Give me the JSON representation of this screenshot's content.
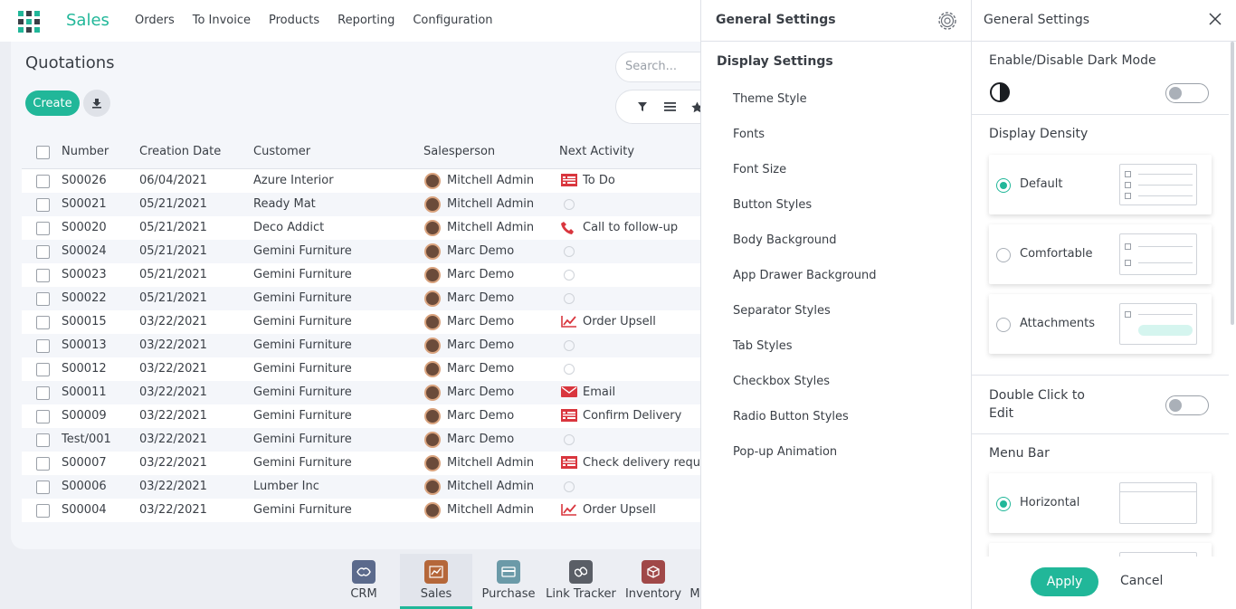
{
  "navbar": {
    "brand": "Sales",
    "menu": [
      "Orders",
      "To Invoice",
      "Products",
      "Reporting",
      "Configuration"
    ]
  },
  "page": {
    "title": "Quotations",
    "create_label": "Create",
    "search_placeholder": "Search..."
  },
  "table": {
    "headers": [
      "Number",
      "Creation Date",
      "Customer",
      "Salesperson",
      "Next Activity"
    ],
    "rows": [
      {
        "number": "S00026",
        "date": "06/04/2021",
        "customer": "Azure Interior",
        "salesperson": "Mitchell Admin",
        "activity": "To Do",
        "activity_icon": "todo-icon"
      },
      {
        "number": "S00021",
        "date": "05/21/2021",
        "customer": "Ready Mat",
        "salesperson": "Mitchell Admin",
        "activity": "",
        "activity_icon": "clock-icon"
      },
      {
        "number": "S00020",
        "date": "05/21/2021",
        "customer": "Deco Addict",
        "salesperson": "Mitchell Admin",
        "activity": "Call to follow-up",
        "activity_icon": "phone-icon"
      },
      {
        "number": "S00024",
        "date": "05/21/2021",
        "customer": "Gemini Furniture",
        "salesperson": "Marc Demo",
        "activity": "",
        "activity_icon": "clock-icon"
      },
      {
        "number": "S00023",
        "date": "05/21/2021",
        "customer": "Gemini Furniture",
        "salesperson": "Marc Demo",
        "activity": "",
        "activity_icon": "clock-icon"
      },
      {
        "number": "S00022",
        "date": "05/21/2021",
        "customer": "Gemini Furniture",
        "salesperson": "Marc Demo",
        "activity": "",
        "activity_icon": "clock-icon"
      },
      {
        "number": "S00015",
        "date": "03/22/2021",
        "customer": "Gemini Furniture",
        "salesperson": "Marc Demo",
        "activity": "Order Upsell",
        "activity_icon": "upsell-icon"
      },
      {
        "number": "S00013",
        "date": "03/22/2021",
        "customer": "Gemini Furniture",
        "salesperson": "Marc Demo",
        "activity": "",
        "activity_icon": "clock-icon"
      },
      {
        "number": "S00012",
        "date": "03/22/2021",
        "customer": "Gemini Furniture",
        "salesperson": "Marc Demo",
        "activity": "",
        "activity_icon": "clock-icon"
      },
      {
        "number": "S00011",
        "date": "03/22/2021",
        "customer": "Gemini Furniture",
        "salesperson": "Marc Demo",
        "activity": "Email",
        "activity_icon": "email-icon"
      },
      {
        "number": "S00009",
        "date": "03/22/2021",
        "customer": "Gemini Furniture",
        "salesperson": "Marc Demo",
        "activity": "Confirm Delivery",
        "activity_icon": "todo-icon"
      },
      {
        "number": "Test/001",
        "date": "03/22/2021",
        "customer": "Gemini Furniture",
        "salesperson": "Marc Demo",
        "activity": "",
        "activity_icon": "clock-icon"
      },
      {
        "number": "S00007",
        "date": "03/22/2021",
        "customer": "Gemini Furniture",
        "salesperson": "Mitchell Admin",
        "activity": "Check delivery require",
        "activity_icon": "todo-icon"
      },
      {
        "number": "S00006",
        "date": "03/22/2021",
        "customer": "Lumber Inc",
        "salesperson": "Mitchell Admin",
        "activity": "",
        "activity_icon": "clock-icon"
      },
      {
        "number": "S00004",
        "date": "03/22/2021",
        "customer": "Gemini Furniture",
        "salesperson": "Mitchell Admin",
        "activity": "Order Upsell",
        "activity_icon": "upsell-icon"
      }
    ]
  },
  "appbar": {
    "apps": [
      {
        "label": "CRM",
        "icon": "crm-icon",
        "color": "#5b6a8c"
      },
      {
        "label": "Sales",
        "icon": "sales-icon",
        "color": "#b5673a",
        "active": true
      },
      {
        "label": "Purchase",
        "icon": "purchase-icon",
        "color": "#6b9aa8"
      },
      {
        "label": "Link Tracker",
        "icon": "link-icon",
        "color": "#5a5e66"
      },
      {
        "label": "Inventory",
        "icon": "inventory-icon",
        "color": "#a04848"
      }
    ],
    "overflow_label": "M"
  },
  "settings_nav": {
    "title": "General Settings",
    "section": "Display Settings",
    "items": [
      "Theme Style",
      "Fonts",
      "Font Size",
      "Button Styles",
      "Body Background",
      "App Drawer Background",
      "Separator Styles",
      "Tab Styles",
      "Checkbox Styles",
      "Radio Button Styles",
      "Pop-up Animation"
    ]
  },
  "settings_panel": {
    "title": "General Settings",
    "dark_mode_label": "Enable/Disable Dark Mode",
    "dark_mode_on": false,
    "density_label": "Display Density",
    "density_options": [
      {
        "label": "Default",
        "selected": true
      },
      {
        "label": "Comfortable",
        "selected": false
      },
      {
        "label": "Attachments",
        "selected": false
      }
    ],
    "double_click_label": "Double Click to Edit",
    "double_click_on": false,
    "menu_bar_label": "Menu Bar",
    "menu_bar_options": [
      {
        "label": "Horizontal",
        "selected": true
      }
    ],
    "apply_label": "Apply",
    "cancel_label": "Cancel"
  },
  "colors": {
    "accent": "#21b799",
    "activity_red": "#d9363e"
  }
}
